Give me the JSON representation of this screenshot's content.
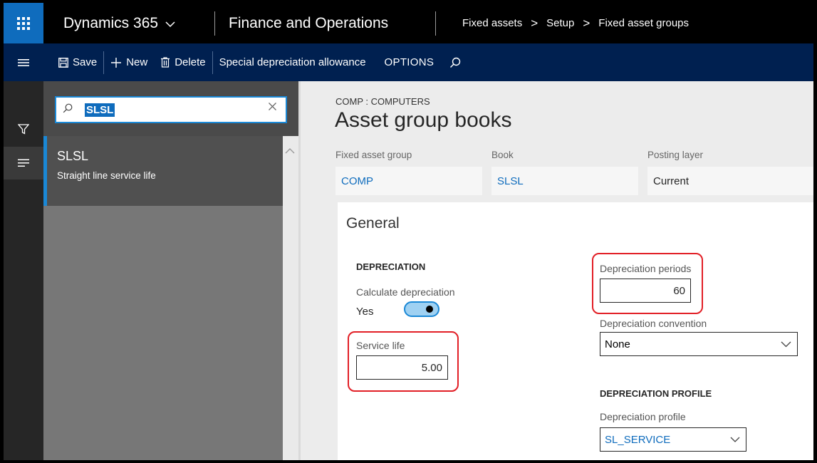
{
  "topbar": {
    "app_name": "Dynamics 365",
    "module_name": "Finance and Operations",
    "breadcrumb": [
      "Fixed assets",
      "Setup",
      "Fixed asset groups"
    ]
  },
  "actionbar": {
    "save": "Save",
    "new": "New",
    "delete": "Delete",
    "special": "Special depreciation allowance",
    "options": "OPTIONS"
  },
  "list": {
    "search_value": "SLSL",
    "items": [
      {
        "code": "SLSL",
        "description": "Straight line service life"
      }
    ]
  },
  "details": {
    "caption": "COMP : COMPUTERS",
    "title": "Asset group books",
    "header_fields": [
      {
        "label": "Fixed asset group",
        "value": "COMP"
      },
      {
        "label": "Book",
        "value": "SLSL"
      },
      {
        "label": "Posting layer",
        "value": "Current"
      }
    ]
  },
  "general": {
    "title": "General",
    "depreciation_heading": "DEPRECIATION",
    "calc_depreciation_label": "Calculate depreciation",
    "calc_depreciation_value": "Yes",
    "service_life_label": "Service life",
    "service_life_value": "5.00",
    "periods_label": "Depreciation periods",
    "periods_value": "60",
    "convention_label": "Depreciation convention",
    "convention_value": "None",
    "profile_heading": "DEPRECIATION PROFILE",
    "profile_label": "Depreciation profile",
    "profile_value": "SL_SERVICE"
  },
  "colors": {
    "accent": "#0f6cbd",
    "action_pane": "#002050",
    "highlight": "#e21f26"
  }
}
